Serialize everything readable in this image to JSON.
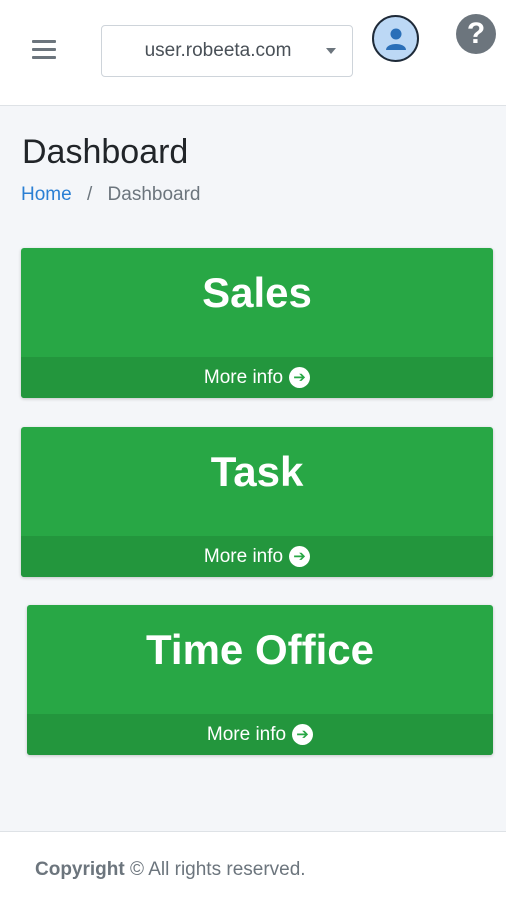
{
  "navbar": {
    "domain_value": "user.robeeta.com",
    "help_symbol": "?"
  },
  "page": {
    "title": "Dashboard"
  },
  "breadcrumb": {
    "home": "Home",
    "separator": "/",
    "current": "Dashboard"
  },
  "cards": [
    {
      "title": "Sales",
      "footer": "More info"
    },
    {
      "title": "Task",
      "footer": "More info"
    },
    {
      "title": "Time Office",
      "footer": "More info"
    }
  ],
  "footer": {
    "bold": "Copyright",
    "symbol": "©",
    "text": "All rights reserved."
  },
  "colors": {
    "card_green": "#28a745",
    "card_footer_green": "#23963d",
    "link_blue": "#2a7fd4"
  }
}
